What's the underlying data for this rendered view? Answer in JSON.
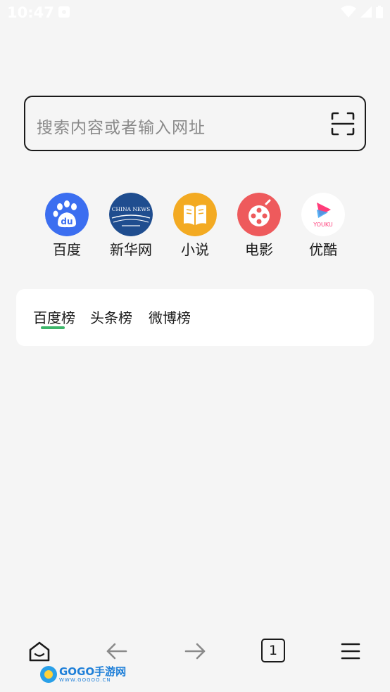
{
  "status_bar": {
    "time": "10:47"
  },
  "search": {
    "placeholder": "搜索内容或者输入网址"
  },
  "quick_links": [
    {
      "label": "百度",
      "icon": "baidu-icon",
      "color": "#3b6ef0"
    },
    {
      "label": "新华网",
      "icon": "china-news-icon",
      "color": "#1f4d8f",
      "logo_text": "CHINA NEWS"
    },
    {
      "label": "小说",
      "icon": "book-icon",
      "color": "#f3aa22"
    },
    {
      "label": "电影",
      "icon": "film-reel-icon",
      "color": "#ee5a5c"
    },
    {
      "label": "优酷",
      "icon": "youku-icon",
      "color": "#ffffff",
      "logo_text": "YOUKU"
    }
  ],
  "trending": {
    "tabs": [
      "百度榜",
      "头条榜",
      "微博榜"
    ],
    "active_tab": "百度榜",
    "accent": "#3cb66a"
  },
  "bottom_nav": {
    "tab_count": "1"
  },
  "watermark": {
    "brand": "GOGO手游网",
    "url": "WWW.GOGOO.CN"
  }
}
